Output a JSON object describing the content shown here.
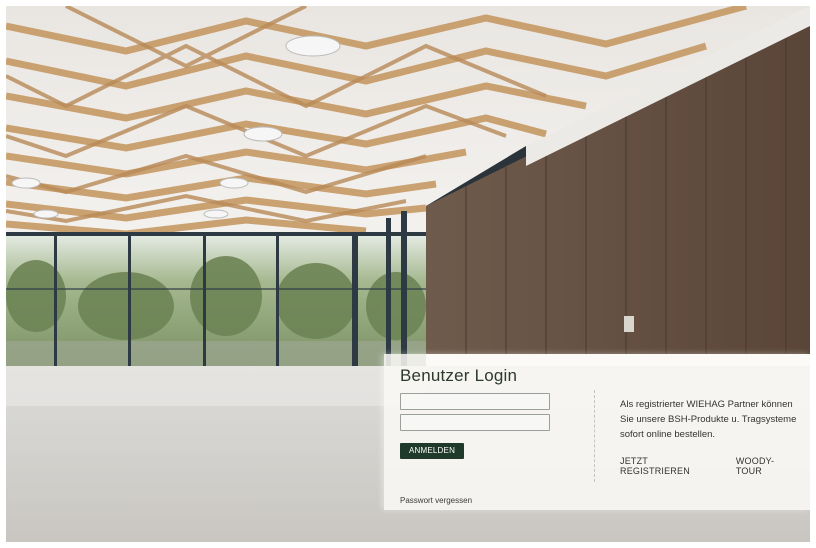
{
  "login": {
    "title": "Benutzer Login",
    "username_placeholder": "",
    "password_placeholder": "",
    "submit_label": "ANMELDEN",
    "forgot_password_label": "Passwort vergessen"
  },
  "info": {
    "description": "Als registrierter WIEHAG Partner können Sie unsere BSH-Produkte u. Tragsysteme sofort online bestellen.",
    "register_label": "JETZT REGISTRIEREN",
    "tour_label": "WOODY-TOUR"
  },
  "colors": {
    "button_bg": "#1f3a2a",
    "panel_bg": "#faf9f6",
    "text": "#333333"
  }
}
